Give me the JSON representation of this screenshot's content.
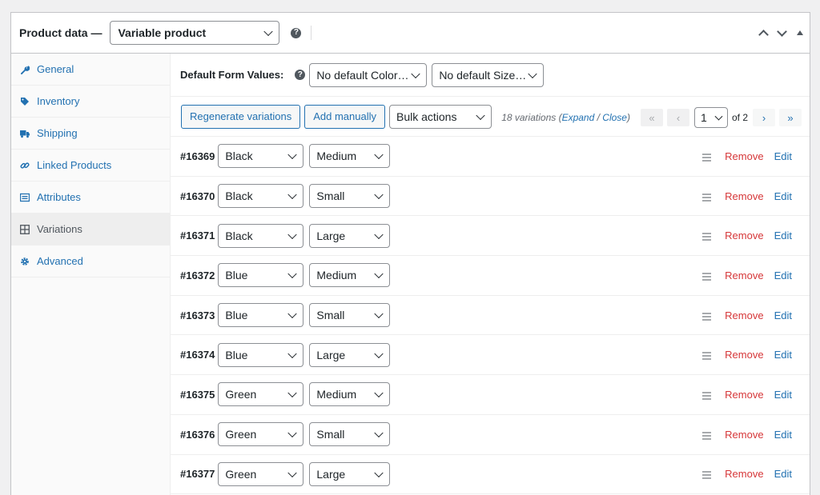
{
  "header": {
    "title": "Product data —",
    "product_type": "Variable product",
    "help": "?"
  },
  "tabs": [
    {
      "label": "General",
      "icon": "wrench-icon"
    },
    {
      "label": "Inventory",
      "icon": "tag-icon"
    },
    {
      "label": "Shipping",
      "icon": "truck-icon"
    },
    {
      "label": "Linked Products",
      "icon": "link-icon"
    },
    {
      "label": "Attributes",
      "icon": "list-icon"
    },
    {
      "label": "Variations",
      "icon": "grid-icon",
      "active": true
    },
    {
      "label": "Advanced",
      "icon": "gear-icon"
    }
  ],
  "defaults": {
    "label": "Default Form Values:",
    "help": "?",
    "color_value": "No default Color…",
    "size_value": "No default Size…"
  },
  "toolbar": {
    "regenerate_label": "Regenerate variations",
    "add_label": "Add manually",
    "bulk_label": "Bulk actions",
    "count_text": "18 variations (",
    "expand_label": "Expand",
    "sep": " / ",
    "close_label": "Close",
    "close_paren": ")",
    "first": "«",
    "prev": "‹",
    "current_page": "1",
    "of_text": "of 2",
    "next": "›",
    "last": "»"
  },
  "variations": [
    {
      "id": "#16369",
      "color": "Black",
      "size": "Medium",
      "remove": "Remove",
      "edit": "Edit"
    },
    {
      "id": "#16370",
      "color": "Black",
      "size": "Small",
      "remove": "Remove",
      "edit": "Edit"
    },
    {
      "id": "#16371",
      "color": "Black",
      "size": "Large",
      "remove": "Remove",
      "edit": "Edit"
    },
    {
      "id": "#16372",
      "color": "Blue",
      "size": "Medium",
      "remove": "Remove",
      "edit": "Edit"
    },
    {
      "id": "#16373",
      "color": "Blue",
      "size": "Small",
      "remove": "Remove",
      "edit": "Edit"
    },
    {
      "id": "#16374",
      "color": "Blue",
      "size": "Large",
      "remove": "Remove",
      "edit": "Edit"
    },
    {
      "id": "#16375",
      "color": "Green",
      "size": "Medium",
      "remove": "Remove",
      "edit": "Edit"
    },
    {
      "id": "#16376",
      "color": "Green",
      "size": "Small",
      "remove": "Remove",
      "edit": "Edit"
    },
    {
      "id": "#16377",
      "color": "Green",
      "size": "Large",
      "remove": "Remove",
      "edit": "Edit"
    }
  ],
  "colors": {
    "link": "#2271b1",
    "remove": "#d63638",
    "border": "#c3c4c7"
  }
}
